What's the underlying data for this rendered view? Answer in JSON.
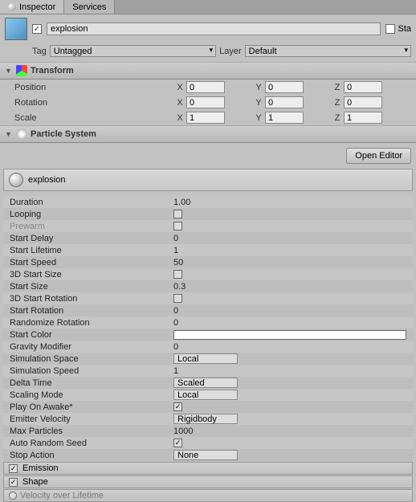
{
  "tabs": {
    "inspector": "Inspector",
    "services": "Services"
  },
  "header": {
    "name": "explosion",
    "static_label": "Sta",
    "tag_label": "Tag",
    "tag_value": "Untagged",
    "layer_label": "Layer",
    "layer_value": "Default"
  },
  "transform": {
    "title": "Transform",
    "position_label": "Position",
    "pos_x": "0",
    "pos_y": "0",
    "pos_z": "0",
    "rotation_label": "Rotation",
    "rot_x": "0",
    "rot_y": "0",
    "rot_z": "0",
    "scale_label": "Scale",
    "scl_x": "1",
    "scl_y": "1",
    "scl_z": "1",
    "x": "X",
    "y": "Y",
    "z": "Z"
  },
  "particle_system": {
    "title": "Particle System",
    "open_editor": "Open Editor",
    "name": "explosion",
    "props": {
      "duration_label": "Duration",
      "duration": "1.00",
      "looping_label": "Looping",
      "prewarm_label": "Prewarm",
      "start_delay_label": "Start Delay",
      "start_delay": "0",
      "start_lifetime_label": "Start Lifetime",
      "start_lifetime": "1",
      "start_speed_label": "Start Speed",
      "start_speed": "50",
      "start_size_3d_label": "3D Start Size",
      "start_size_label": "Start Size",
      "start_size": "0.3",
      "start_rot_3d_label": "3D Start Rotation",
      "start_rotation_label": "Start Rotation",
      "start_rotation": "0",
      "randomize_rot_label": "Randomize Rotation",
      "randomize_rot": "0",
      "start_color_label": "Start Color",
      "gravity_label": "Gravity Modifier",
      "gravity": "0",
      "sim_space_label": "Simulation Space",
      "sim_space": "Local",
      "sim_speed_label": "Simulation Speed",
      "sim_speed": "1",
      "delta_time_label": "Delta Time",
      "delta_time": "Scaled",
      "scaling_mode_label": "Scaling Mode",
      "scaling_mode": "Local",
      "play_awake_label": "Play On Awake*",
      "emitter_vel_label": "Emitter Velocity",
      "emitter_vel": "Rigidbody",
      "max_particles_label": "Max Particles",
      "max_particles": "1000",
      "auto_seed_label": "Auto Random Seed",
      "stop_action_label": "Stop Action",
      "stop_action": "None"
    },
    "modules": {
      "emission": "Emission",
      "shape": "Shape",
      "velocity_lifetime": "Velocity over Lifetime"
    }
  }
}
